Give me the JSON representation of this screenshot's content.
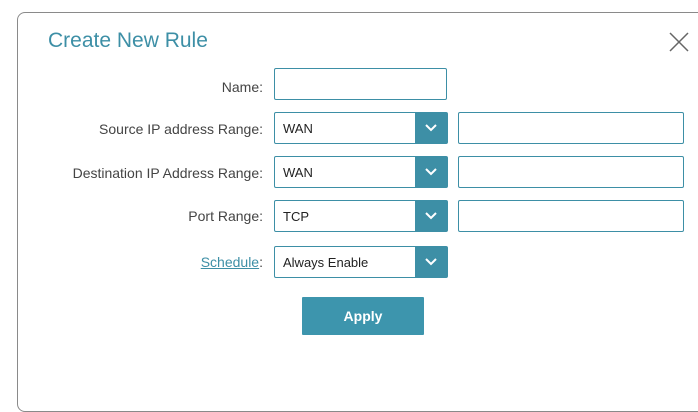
{
  "dialog": {
    "title": "Create New Rule"
  },
  "form": {
    "name_label": "Name:",
    "name_value": "",
    "source_label": "Source IP address Range:",
    "source_select": "WAN",
    "source_value": "",
    "dest_label": "Destination IP Address Range:",
    "dest_select": "WAN",
    "dest_value": "",
    "port_label": "Port Range:",
    "port_select": "TCP",
    "port_value": "",
    "schedule_link": "Schedule",
    "schedule_colon": ":",
    "schedule_select": "Always Enable",
    "apply_label": "Apply"
  },
  "colors": {
    "accent": "#3d8fa6",
    "button": "#3d95ad"
  },
  "icons": {
    "close": "close-icon",
    "dropdown": "chevron-down-icon"
  }
}
